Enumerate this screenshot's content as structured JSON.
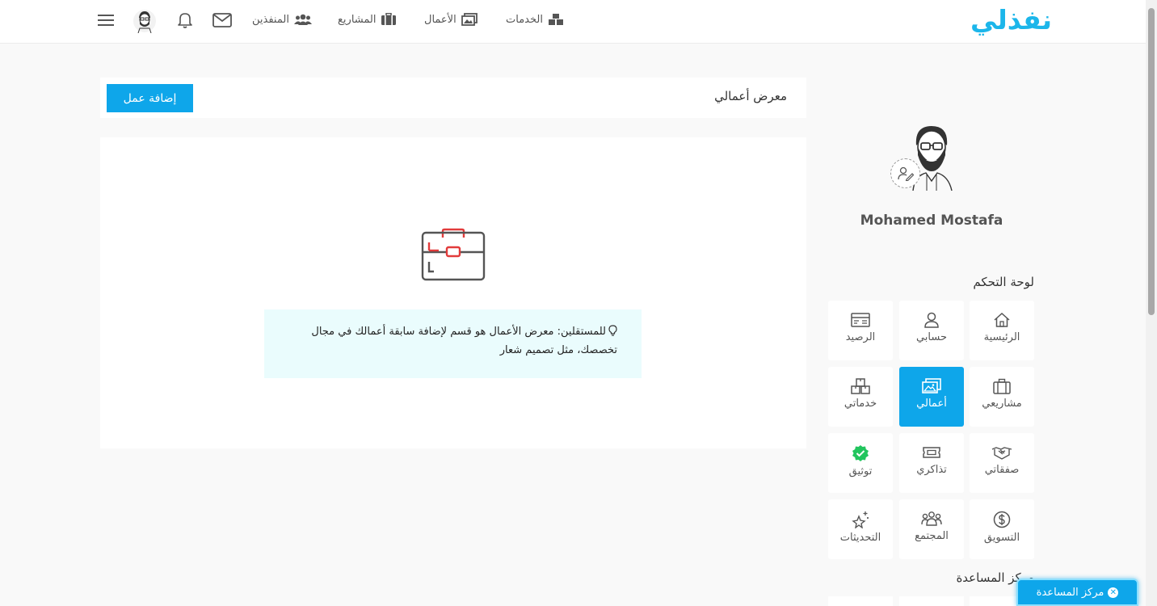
{
  "brand": {
    "logo": "نفذلي",
    "color": "#1cb6ea"
  },
  "nav": {
    "services": "الخدمات",
    "works": "الأعمال",
    "projects": "المشاريع",
    "executors": "المنفذين"
  },
  "header": {
    "title": "معرض أعمالي",
    "add_button": "إضافة عمل"
  },
  "tip": {
    "text": "للمستقلين: معرض الأعمال هو قسم لإضافة سابقة أعمالك في مجال تخصصك، مثل تصميم شعار"
  },
  "profile": {
    "name": "Mohamed Mostafa"
  },
  "dashboard": {
    "title": "لوحة التحكم",
    "tiles": [
      {
        "label": "الرئيسية",
        "icon": "home-icon"
      },
      {
        "label": "حسابي",
        "icon": "user-icon"
      },
      {
        "label": "الرصيد",
        "icon": "wallet-icon"
      },
      {
        "label": "مشاريعي",
        "icon": "briefcase-icon"
      },
      {
        "label": "أعمالي",
        "icon": "gallery-icon",
        "active": true
      },
      {
        "label": "خدماتي",
        "icon": "boxes-icon"
      },
      {
        "label": "صفقاتي",
        "icon": "handshake-icon"
      },
      {
        "label": "تذاكري",
        "icon": "ticket-icon"
      },
      {
        "label": "توثيق",
        "icon": "verified-icon"
      },
      {
        "label": "التسويق",
        "icon": "dollar-icon"
      },
      {
        "label": "المجتمع",
        "icon": "community-icon"
      },
      {
        "label": "التحديثات",
        "icon": "sparkle-icon"
      }
    ]
  },
  "help_center": {
    "title": "مركز المساعدة",
    "button": "مركز المساعدة"
  },
  "colors": {
    "accent": "#0ea6ea",
    "tip_bg": "#eafcfd",
    "verified": "#22c55e"
  }
}
